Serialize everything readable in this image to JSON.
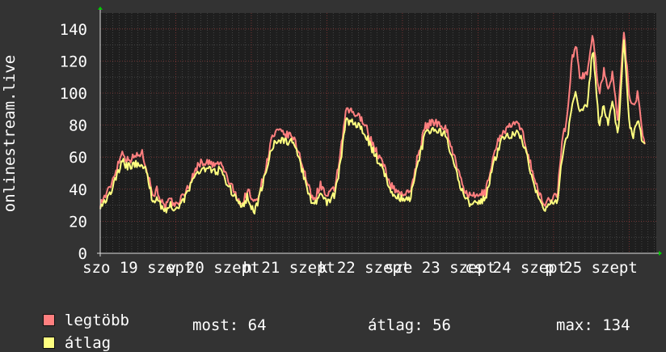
{
  "chart_data": {
    "type": "line",
    "ylabel": "onlinestream.live",
    "ylim": [
      0,
      150
    ],
    "yticks": [
      0,
      20,
      40,
      60,
      80,
      100,
      120,
      140
    ],
    "xlim_days": [
      0,
      7.36
    ],
    "x_tick_labels": [
      "szo 19 szept",
      "v 20 szept",
      "h 21 szept",
      "k 22 szept",
      "sze 23 szept",
      "cs 24 szept",
      "p 25 szept"
    ],
    "grid": true,
    "legend_placement": "bottom-left",
    "series": [
      {
        "name": "legtöbb",
        "color": "#ff7f7f",
        "anchors": [
          [
            0,
            31
          ],
          [
            0.12,
            40
          ],
          [
            0.25,
            58
          ],
          [
            0.3,
            64
          ],
          [
            0.35,
            58
          ],
          [
            0.45,
            60
          ],
          [
            0.55,
            63
          ],
          [
            0.6,
            56
          ],
          [
            0.65,
            46
          ],
          [
            0.7,
            36
          ],
          [
            0.75,
            40
          ],
          [
            0.85,
            28
          ],
          [
            0.92,
            33
          ],
          [
            1.0,
            30
          ],
          [
            1.1,
            36
          ],
          [
            1.2,
            45
          ],
          [
            1.3,
            56
          ],
          [
            1.4,
            57
          ],
          [
            1.5,
            55
          ],
          [
            1.6,
            56
          ],
          [
            1.7,
            45
          ],
          [
            1.8,
            36
          ],
          [
            1.88,
            30
          ],
          [
            1.95,
            40
          ],
          [
            2.03,
            31
          ],
          [
            2.1,
            37
          ],
          [
            2.2,
            55
          ],
          [
            2.27,
            72
          ],
          [
            2.35,
            76
          ],
          [
            2.45,
            74
          ],
          [
            2.55,
            73
          ],
          [
            2.65,
            60
          ],
          [
            2.75,
            42
          ],
          [
            2.82,
            33
          ],
          [
            2.92,
            43
          ],
          [
            3.0,
            35
          ],
          [
            3.1,
            40
          ],
          [
            3.18,
            62
          ],
          [
            3.25,
            88
          ],
          [
            3.3,
            89
          ],
          [
            3.4,
            86
          ],
          [
            3.5,
            82
          ],
          [
            3.55,
            74
          ],
          [
            3.65,
            64
          ],
          [
            3.75,
            55
          ],
          [
            3.85,
            42
          ],
          [
            3.95,
            38
          ],
          [
            4.1,
            37
          ],
          [
            4.2,
            60
          ],
          [
            4.3,
            79
          ],
          [
            4.4,
            82
          ],
          [
            4.5,
            81
          ],
          [
            4.58,
            78
          ],
          [
            4.7,
            58
          ],
          [
            4.8,
            41
          ],
          [
            4.9,
            35
          ],
          [
            5.0,
            36
          ],
          [
            5.1,
            38
          ],
          [
            5.2,
            60
          ],
          [
            5.3,
            75
          ],
          [
            5.4,
            78
          ],
          [
            5.5,
            82
          ],
          [
            5.6,
            74
          ],
          [
            5.7,
            55
          ],
          [
            5.8,
            38
          ],
          [
            5.88,
            30
          ],
          [
            5.97,
            35
          ],
          [
            6.05,
            37
          ],
          [
            6.12,
            72
          ],
          [
            6.18,
            84
          ],
          [
            6.24,
            120
          ],
          [
            6.3,
            130
          ],
          [
            6.35,
            110
          ],
          [
            6.45,
            112
          ],
          [
            6.52,
            139
          ],
          [
            6.6,
            100
          ],
          [
            6.67,
            114
          ],
          [
            6.72,
            100
          ],
          [
            6.78,
            112
          ],
          [
            6.85,
            84
          ],
          [
            6.93,
            139
          ],
          [
            7.0,
            100
          ],
          [
            7.05,
            92
          ],
          [
            7.12,
            100
          ],
          [
            7.16,
            80
          ],
          [
            7.2,
            72
          ],
          [
            7.22,
            66
          ]
        ]
      },
      {
        "name": "átlag",
        "color": "#ffff80",
        "anchors": [
          [
            0,
            30
          ],
          [
            0.12,
            36
          ],
          [
            0.25,
            52
          ],
          [
            0.3,
            58
          ],
          [
            0.35,
            54
          ],
          [
            0.45,
            55
          ],
          [
            0.55,
            57
          ],
          [
            0.6,
            52
          ],
          [
            0.65,
            42
          ],
          [
            0.7,
            32
          ],
          [
            0.75,
            35
          ],
          [
            0.85,
            26
          ],
          [
            0.92,
            30
          ],
          [
            1.0,
            28
          ],
          [
            1.1,
            33
          ],
          [
            1.2,
            42
          ],
          [
            1.3,
            52
          ],
          [
            1.4,
            53
          ],
          [
            1.5,
            51
          ],
          [
            1.6,
            52
          ],
          [
            1.7,
            42
          ],
          [
            1.8,
            33
          ],
          [
            1.88,
            28
          ],
          [
            1.95,
            36
          ],
          [
            2.03,
            25
          ],
          [
            2.1,
            34
          ],
          [
            2.2,
            52
          ],
          [
            2.27,
            66
          ],
          [
            2.35,
            71
          ],
          [
            2.45,
            70
          ],
          [
            2.55,
            69
          ],
          [
            2.65,
            56
          ],
          [
            2.75,
            38
          ],
          [
            2.82,
            29
          ],
          [
            2.92,
            38
          ],
          [
            3.0,
            32
          ],
          [
            3.1,
            36
          ],
          [
            3.18,
            56
          ],
          [
            3.25,
            83
          ],
          [
            3.3,
            82
          ],
          [
            3.4,
            80
          ],
          [
            3.5,
            76
          ],
          [
            3.55,
            70
          ],
          [
            3.65,
            60
          ],
          [
            3.75,
            51
          ],
          [
            3.85,
            39
          ],
          [
            3.95,
            35
          ],
          [
            4.1,
            34
          ],
          [
            4.2,
            55
          ],
          [
            4.3,
            74
          ],
          [
            4.4,
            77
          ],
          [
            4.5,
            76
          ],
          [
            4.58,
            73
          ],
          [
            4.7,
            52
          ],
          [
            4.8,
            37
          ],
          [
            4.9,
            30
          ],
          [
            5.0,
            32
          ],
          [
            5.1,
            34
          ],
          [
            5.2,
            55
          ],
          [
            5.3,
            70
          ],
          [
            5.4,
            73
          ],
          [
            5.5,
            76
          ],
          [
            5.6,
            69
          ],
          [
            5.7,
            51
          ],
          [
            5.8,
            34
          ],
          [
            5.88,
            28
          ],
          [
            5.97,
            31
          ],
          [
            6.05,
            33
          ],
          [
            6.12,
            62
          ],
          [
            6.18,
            72
          ],
          [
            6.24,
            90
          ],
          [
            6.3,
            100
          ],
          [
            6.35,
            88
          ],
          [
            6.45,
            92
          ],
          [
            6.52,
            130
          ],
          [
            6.6,
            80
          ],
          [
            6.67,
            92
          ],
          [
            6.72,
            80
          ],
          [
            6.78,
            95
          ],
          [
            6.85,
            72
          ],
          [
            6.93,
            132
          ],
          [
            7.0,
            82
          ],
          [
            7.05,
            72
          ],
          [
            7.12,
            85
          ],
          [
            7.16,
            72
          ],
          [
            7.2,
            68
          ],
          [
            7.22,
            64
          ]
        ]
      }
    ]
  },
  "legend": {
    "items": [
      {
        "label": "legtöbb",
        "color": "#ff7f7f"
      },
      {
        "label": "átlag",
        "color": "#ffff80"
      }
    ],
    "stats": {
      "most": "most: 64",
      "atlag": "átlag: 56",
      "max": "max: 134"
    }
  }
}
